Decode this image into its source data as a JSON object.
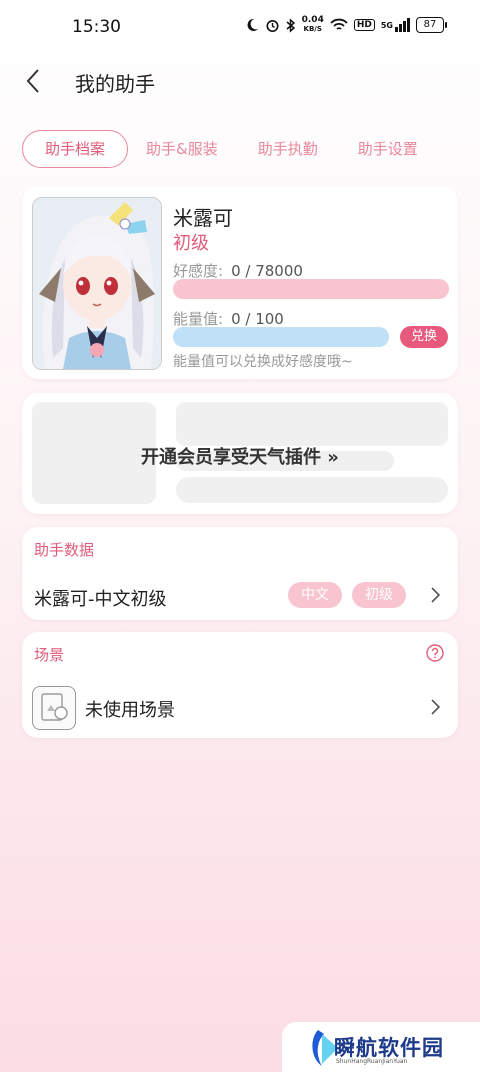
{
  "status_bar": {
    "time": "15:30",
    "net_speed_value": "0.04",
    "net_speed_unit": "KB/S",
    "hd_badge": "HD",
    "network_type": "5G",
    "battery": "87"
  },
  "header": {
    "title": "我的助手"
  },
  "tabs": [
    {
      "label": "助手档案"
    },
    {
      "label": "助手&服装"
    },
    {
      "label": "助手执勤"
    },
    {
      "label": "助手设置"
    }
  ],
  "profile": {
    "name": "米露可",
    "level": "初级",
    "favor_label": "好感度:",
    "favor_value": "0 / 78000",
    "favor_progress": 0,
    "energy_label": "能量值:",
    "energy_value": "0 / 100",
    "energy_progress": 0,
    "exchange_button": "兑换",
    "hint": "能量值可以兑换成好感度哦~"
  },
  "promo": {
    "text": "开通会员享受天气插件 »"
  },
  "assistant_data": {
    "section_title": "助手数据",
    "row_label": "米露可-中文初级",
    "chip_language": "中文",
    "chip_level": "初级"
  },
  "scene": {
    "section_title": "场景",
    "row_label": "未使用场景"
  },
  "watermark": {
    "name": "瞬航软件园",
    "pinyin": "ShunHangRuanJianYuan"
  },
  "colors": {
    "accent": "#e05c7a",
    "favor_bar": "#f8c4d0",
    "energy_bar": "#bfe0f6",
    "exchange_bg": "#e85a7d"
  }
}
